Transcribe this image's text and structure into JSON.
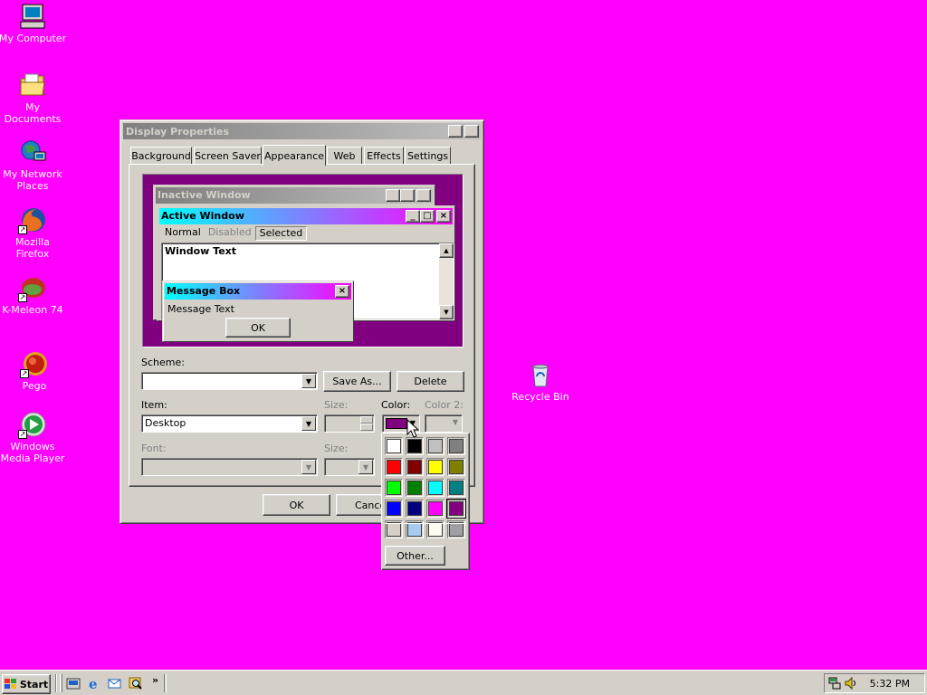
{
  "desktop": {
    "icons": [
      {
        "label": "My Computer",
        "icon": "computer-icon"
      },
      {
        "label": "My Documents",
        "icon": "folder-icon"
      },
      {
        "label": "My Network Places",
        "icon": "network-icon"
      },
      {
        "label": "Mozilla Firefox",
        "icon": "firefox-icon"
      },
      {
        "label": "K-Meleon 74",
        "icon": "kmeleon-icon"
      },
      {
        "label": "Pego",
        "icon": "pego-icon"
      },
      {
        "label": "Windows Media Player",
        "icon": "media-player-icon"
      },
      {
        "label": "Recycle Bin",
        "icon": "recycle-bin-icon"
      }
    ],
    "background_color": "#ff00ff"
  },
  "dialog": {
    "title": "Display Properties",
    "help_button": "?",
    "close_button": "×",
    "tabs": [
      "Background",
      "Screen Saver",
      "Appearance",
      "Web",
      "Effects",
      "Settings"
    ],
    "active_tab": "Appearance",
    "preview": {
      "inactive_title": "Inactive Window",
      "active_title": "Active Window",
      "menu_normal": "Normal",
      "menu_disabled": "Disabled",
      "menu_selected": "Selected",
      "window_text": "Window Text",
      "msgbox_title": "Message Box",
      "msgbox_text": "Message Text",
      "msgbox_ok": "OK"
    },
    "scheme_label": "Scheme:",
    "scheme_value": "",
    "save_as_label": "Save As...",
    "delete_label": "Delete",
    "item_label": "Item:",
    "item_value": "Desktop",
    "size_label": "Size:",
    "color_label": "Color:",
    "color2_label": "Color 2:",
    "font_label": "Font:",
    "font_size_label": "Size:",
    "ok_label": "OK",
    "cancel_label": "Cance",
    "selected_color": "#800080"
  },
  "color_popup": {
    "swatches": [
      "#ffffff",
      "#000000",
      "#c0c0c0",
      "#808080",
      "#ff0000",
      "#800000",
      "#ffff00",
      "#808000",
      "#00ff00",
      "#008000",
      "#00ffff",
      "#008080",
      "#0000ff",
      "#000080",
      "#ff00ff",
      "#800080",
      "#d4d0c8",
      "#a6caf0",
      "#fffbf0",
      "#a0a0a4"
    ],
    "selected_index": 15,
    "other_label": "Other..."
  },
  "taskbar": {
    "start_label": "Start",
    "quick_launch": [
      "show-desktop-icon",
      "internet-explorer-icon",
      "outlook-express-icon",
      "search-icon"
    ],
    "overflow": "»",
    "clock": "5:32 PM"
  }
}
